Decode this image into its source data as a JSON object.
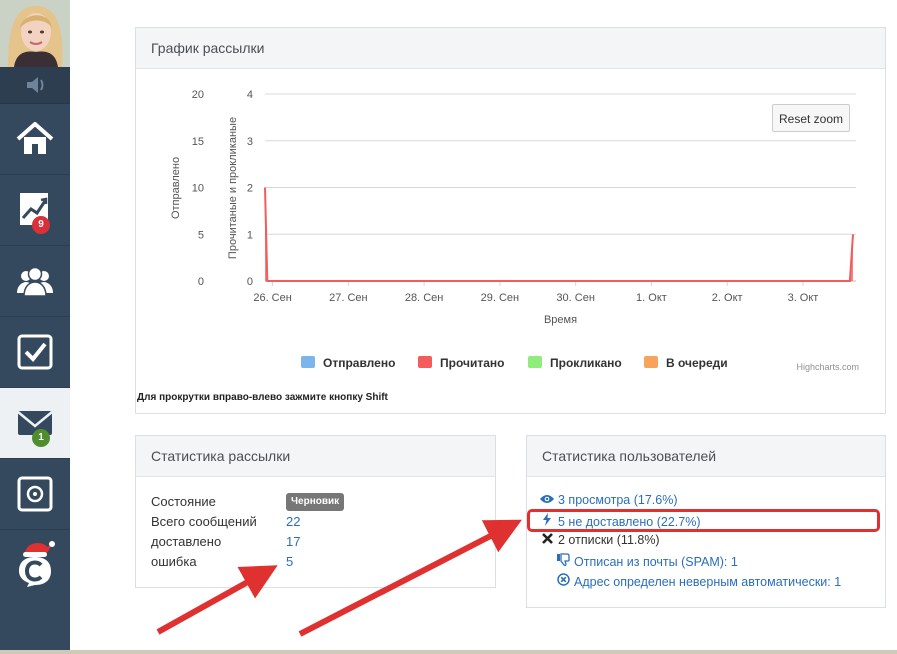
{
  "sidebar": {
    "items": [
      {
        "icon": "home-icon"
      },
      {
        "icon": "chart-icon",
        "badge": "9"
      },
      {
        "icon": "users-icon"
      },
      {
        "icon": "checkbox-icon"
      },
      {
        "icon": "mail-icon",
        "badge": "1",
        "active": true
      },
      {
        "icon": "safe-icon"
      },
      {
        "icon": "santa-logo-icon"
      }
    ]
  },
  "chart_panel": {
    "title": "График рассылки",
    "reset_zoom": "Reset zoom",
    "credits": "Highcharts.com",
    "hint": "Для прокрутки вправо-влево зажмите кнопку Shift"
  },
  "chart_data": {
    "type": "area",
    "xlabel": "Время",
    "ylabel_left": "Отправлено",
    "ylabel_right": "Прочитаные и прокликаные",
    "categories": [
      "26. Сен",
      "27. Сен",
      "28. Сен",
      "29. Сен",
      "30. Сен",
      "1. Окт",
      "2. Окт",
      "3. Окт"
    ],
    "y_left_ticks": [
      "0",
      "5",
      "10",
      "15",
      "20"
    ],
    "y_right_ticks": [
      "0",
      "1",
      "2",
      "3",
      "4"
    ],
    "y_left_lim": [
      0,
      20
    ],
    "y_right_lim": [
      0,
      4
    ],
    "x_lim_days": [
      -0.1,
      7.7
    ],
    "series": [
      {
        "name": "Отправлено",
        "color": "#7cb5ec",
        "points": []
      },
      {
        "name": "Прочитано",
        "color": "#f45b5b",
        "points": [
          [
            -0.1,
            2
          ],
          [
            -0.07,
            0
          ],
          [
            7.62,
            0
          ],
          [
            7.66,
            1
          ]
        ]
      },
      {
        "name": "Прокликано",
        "color": "#90ed7d",
        "points": []
      },
      {
        "name": "В очереди",
        "color": "#f7a35c",
        "points": []
      }
    ],
    "grid": true,
    "legend": "bottom-center"
  },
  "mail_stats": {
    "title": "Статистика рассылки",
    "rows": [
      {
        "label": "Состояние",
        "badge": "Черновик"
      },
      {
        "label": "Всего сообщений",
        "value": "22"
      },
      {
        "label": "доставлено",
        "value": "17"
      },
      {
        "label": "ошибка",
        "value": "5"
      }
    ]
  },
  "user_stats": {
    "title": "Статистика пользователей",
    "links": [
      {
        "icon": "eye-icon",
        "text": "3 просмотра (17.6%)"
      },
      {
        "icon": "bolt-icon",
        "text": "5 не доставлено (22.7%)"
      },
      {
        "icon": "x-icon",
        "text": "2 отписки (11.8%)"
      },
      {
        "icon": "thumbs-down-icon",
        "text": "Отписан из почты (SPAM): 1"
      },
      {
        "icon": "x-circle-icon",
        "text": "Адрес определен неверным автоматически: 1"
      }
    ]
  }
}
